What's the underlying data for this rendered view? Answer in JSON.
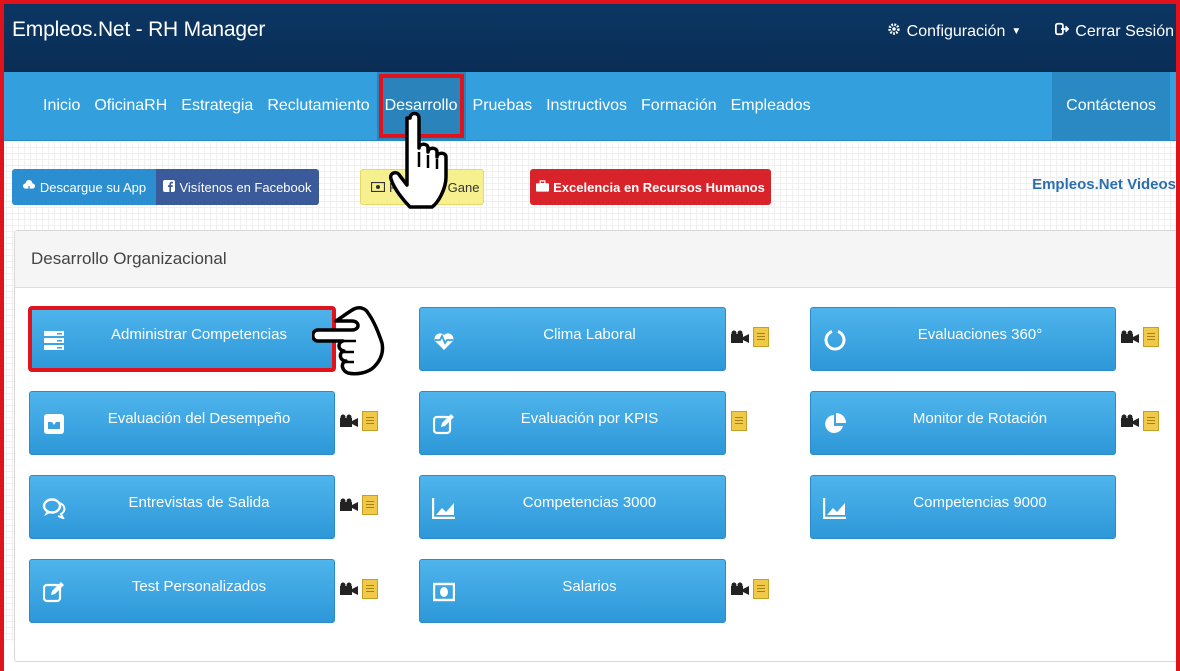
{
  "app": {
    "title": "Empleos.Net - RH Manager"
  },
  "topnav": {
    "config": "Configuración",
    "logout": "Cerrar Sesión"
  },
  "nav": {
    "items": [
      "Inicio",
      "OficinaRH",
      "Estrategia",
      "Reclutamiento",
      "Desarrollo",
      "Pruebas",
      "Instructivos",
      "Formación",
      "Empleados"
    ],
    "active": "Desarrollo",
    "contact": "Contáctenos"
  },
  "actions": {
    "app": "Descargue su App",
    "facebook": "Visítenos en Facebook",
    "yellow_left": "Re",
    "yellow_right": "Gane",
    "excellence": "Excelencia en Recursos Humanos",
    "videos": "Empleos.Net Videos"
  },
  "panel": {
    "title": "Desarrollo Organizacional",
    "cards": [
      {
        "label": "Administrar Competencias",
        "icon": "server-icon"
      },
      {
        "label": "Clima Laboral",
        "icon": "heartbeat-icon"
      },
      {
        "label": "Evaluaciones 360°",
        "icon": "circle-notch-icon"
      },
      {
        "label": "Evaluación del Desempeño",
        "icon": "inbox-icon"
      },
      {
        "label": "Evaluación por KPIS",
        "icon": "edit-icon"
      },
      {
        "label": "Monitor de Rotación",
        "icon": "pie-chart-icon"
      },
      {
        "label": "Entrevistas de Salida",
        "icon": "comments-icon"
      },
      {
        "label": "Competencias 3000",
        "icon": "area-chart-icon"
      },
      {
        "label": "Competencias 9000",
        "icon": "area-chart-icon"
      },
      {
        "label": "Test Personalizados",
        "icon": "edit-icon"
      },
      {
        "label": "Salarios",
        "icon": "money-icon"
      }
    ]
  },
  "colors": {
    "accent": "#33a0dd",
    "topbar": "#0b3764",
    "highlight": "#e0121b"
  }
}
